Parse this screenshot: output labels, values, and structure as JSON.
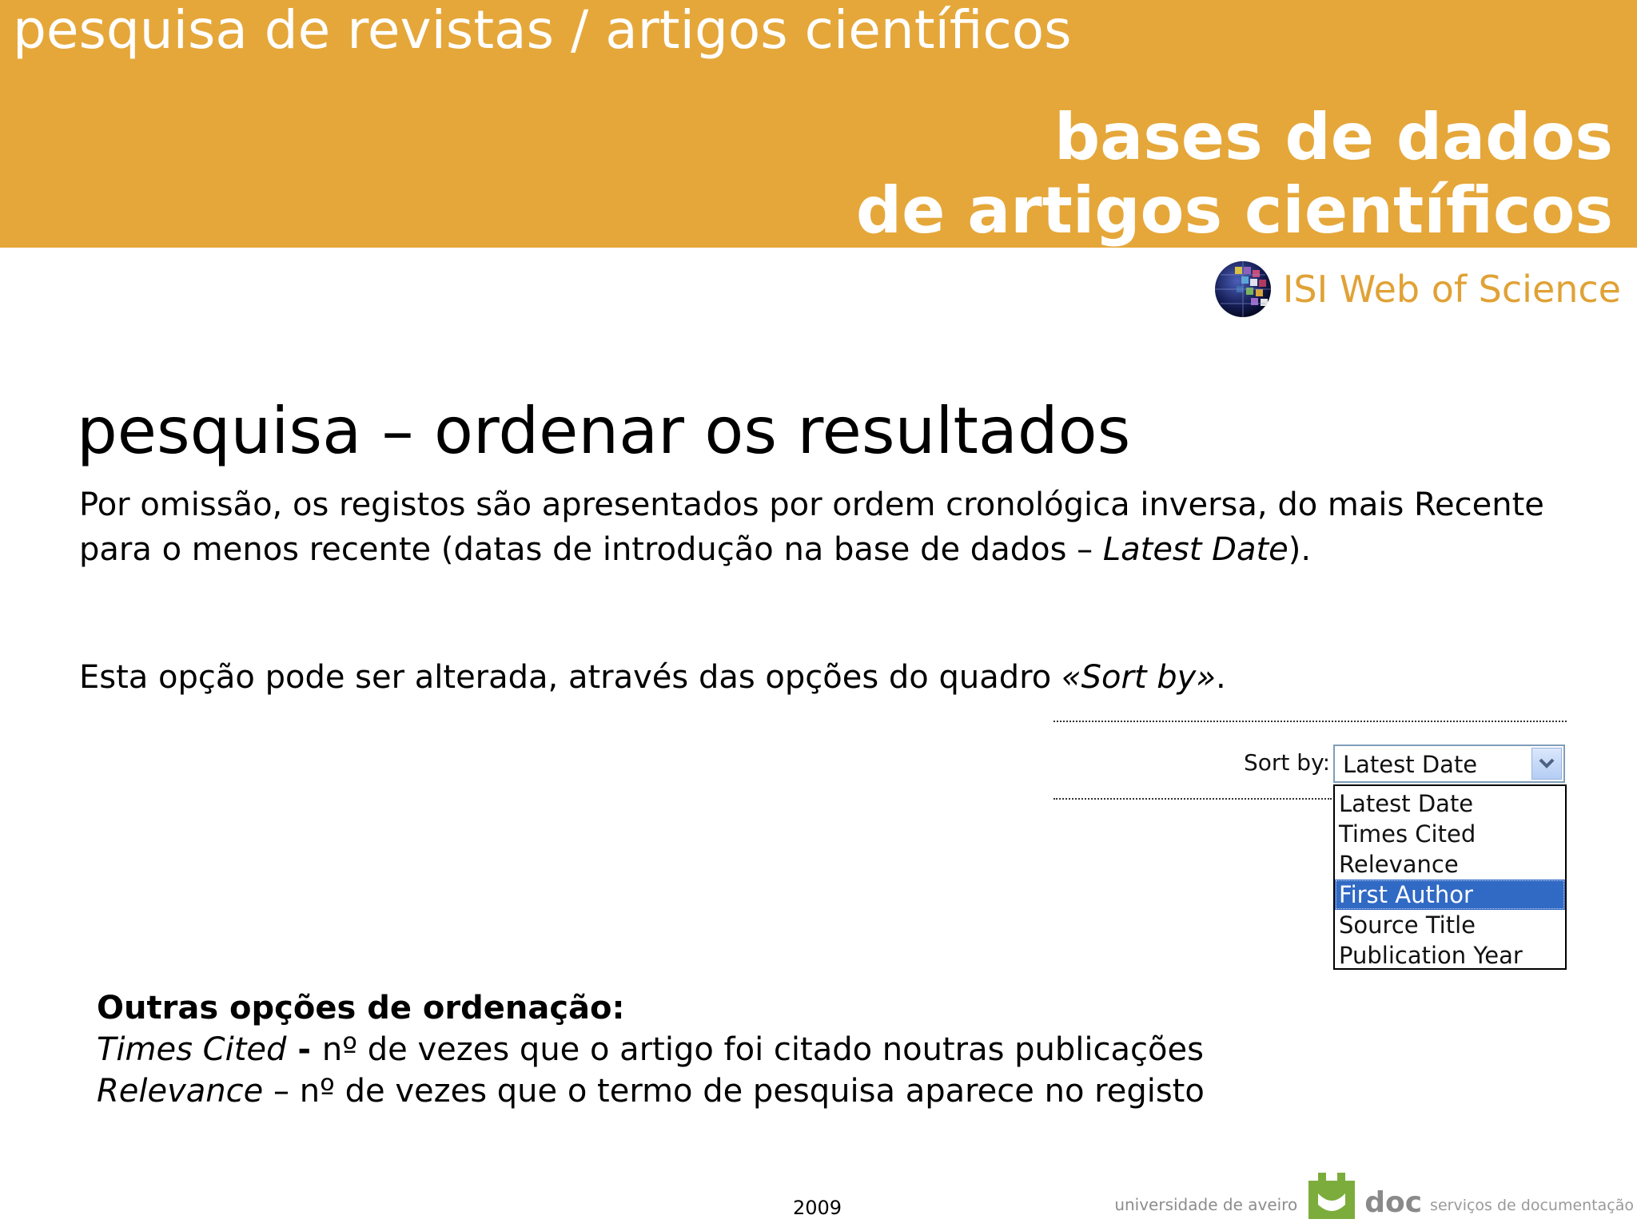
{
  "header": {
    "top_line": "pesquisa de revistas / artigos científicos",
    "title_line1": "bases de dados",
    "title_line2": "de artigos científicos"
  },
  "brand": {
    "isi_label": "ISI Web of Science",
    "isi_icon": "globe-icon"
  },
  "main": {
    "heading": "pesquisa – ordenar os resultados",
    "p1_text": "Por omissão, os registos são apresentados por ordem cronológica inversa, do mais Recente para o menos recente (datas de introdução na base de dados – ",
    "p1_italic": "Latest Date",
    "p1_end": ").",
    "p2_text": "Esta opção pode ser alterada, através das opções do quadro ",
    "p2_italic": "«Sort by»",
    "p2_end": "."
  },
  "sort_widget": {
    "label": "Sort by:",
    "selected_value": "Latest Date",
    "options": [
      "Latest Date",
      "Times Cited",
      "Relevance",
      "First Author",
      "Source Title",
      "Publication Year"
    ],
    "highlighted": "First Author",
    "highlight_color": "#316AC5"
  },
  "other": {
    "title": "Outras opções de ordenação:",
    "times_cited_term": "Times Cited",
    "times_cited_sep": " - ",
    "times_cited_desc": "nº de vezes que o artigo foi citado noutras publicações",
    "relevance_term": "Relevance",
    "relevance_sep": " – ",
    "relevance_desc": "nº de vezes que o termo de pesquisa aparece no registo"
  },
  "footer": {
    "year": "2009",
    "university": "universidade de aveiro",
    "doc": "doc",
    "services": "serviços de documentação"
  },
  "colors": {
    "banner": "#E5A73A",
    "isi_text": "#E0A236"
  }
}
